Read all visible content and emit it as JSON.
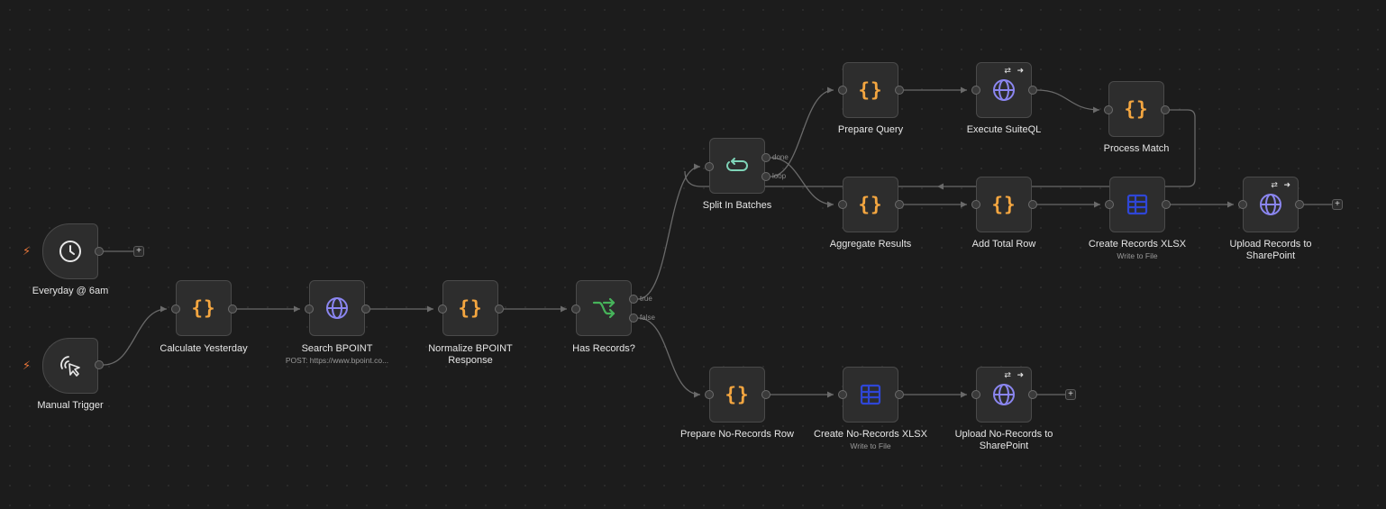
{
  "colors": {
    "background": "#1c1c1c",
    "node_fill": "#2d2d2d",
    "node_border": "#4a4a4a",
    "edge": "#6a6a6a",
    "code_icon": "#f4a640",
    "http_icon": "#8b86f0",
    "sheet_icon": "#2f46d6",
    "if_icon": "#46b35a",
    "split_icon": "#7fd4b8",
    "trigger_bolt": "#e8763a"
  },
  "nodes": {
    "everyday": {
      "label": "Everyday @ 6am",
      "icon": "clock-icon"
    },
    "manual": {
      "label": "Manual Trigger",
      "icon": "cursor-click-icon"
    },
    "calc_yesterday": {
      "label": "Calculate Yesterday",
      "icon": "code-braces-icon"
    },
    "search_bpoint": {
      "label": "Search BPOINT",
      "sublabel": "POST: https://www.bpoint.co...",
      "icon": "globe-icon"
    },
    "normalize": {
      "label": "Normalize BPOINT Response",
      "icon": "code-braces-icon"
    },
    "has_records": {
      "label": "Has Records?",
      "icon": "branch-icon",
      "outputs": [
        "true",
        "false"
      ]
    },
    "split_batches": {
      "label": "Split In Batches",
      "icon": "loop-icon",
      "outputs": [
        "done",
        "loop"
      ]
    },
    "prepare_query": {
      "label": "Prepare Query",
      "icon": "code-braces-icon"
    },
    "execute_suiteql": {
      "label": "Execute SuiteQL",
      "icon": "globe-icon",
      "badge": "⇄ ➜"
    },
    "process_match": {
      "label": "Process Match",
      "icon": "code-braces-icon"
    },
    "aggregate": {
      "label": "Aggregate Results",
      "icon": "code-braces-icon"
    },
    "add_total": {
      "label": "Add Total Row",
      "icon": "code-braces-icon"
    },
    "create_records": {
      "label": "Create Records XLSX",
      "sublabel": "Write to File",
      "icon": "sheet-icon"
    },
    "upload_records": {
      "label": "Upload Records to SharePoint",
      "icon": "globe-icon",
      "badge": "⇄ ➜"
    },
    "prepare_norecords": {
      "label": "Prepare No-Records Row",
      "icon": "code-braces-icon"
    },
    "create_norecords": {
      "label": "Create No-Records XLSX",
      "sublabel": "Write to File",
      "icon": "sheet-icon"
    },
    "upload_norecords": {
      "label": "Upload No-Records to SharePoint",
      "icon": "globe-icon",
      "badge": "⇄ ➜"
    }
  },
  "symbols": {
    "plus": "+",
    "bolt": "⚡"
  }
}
